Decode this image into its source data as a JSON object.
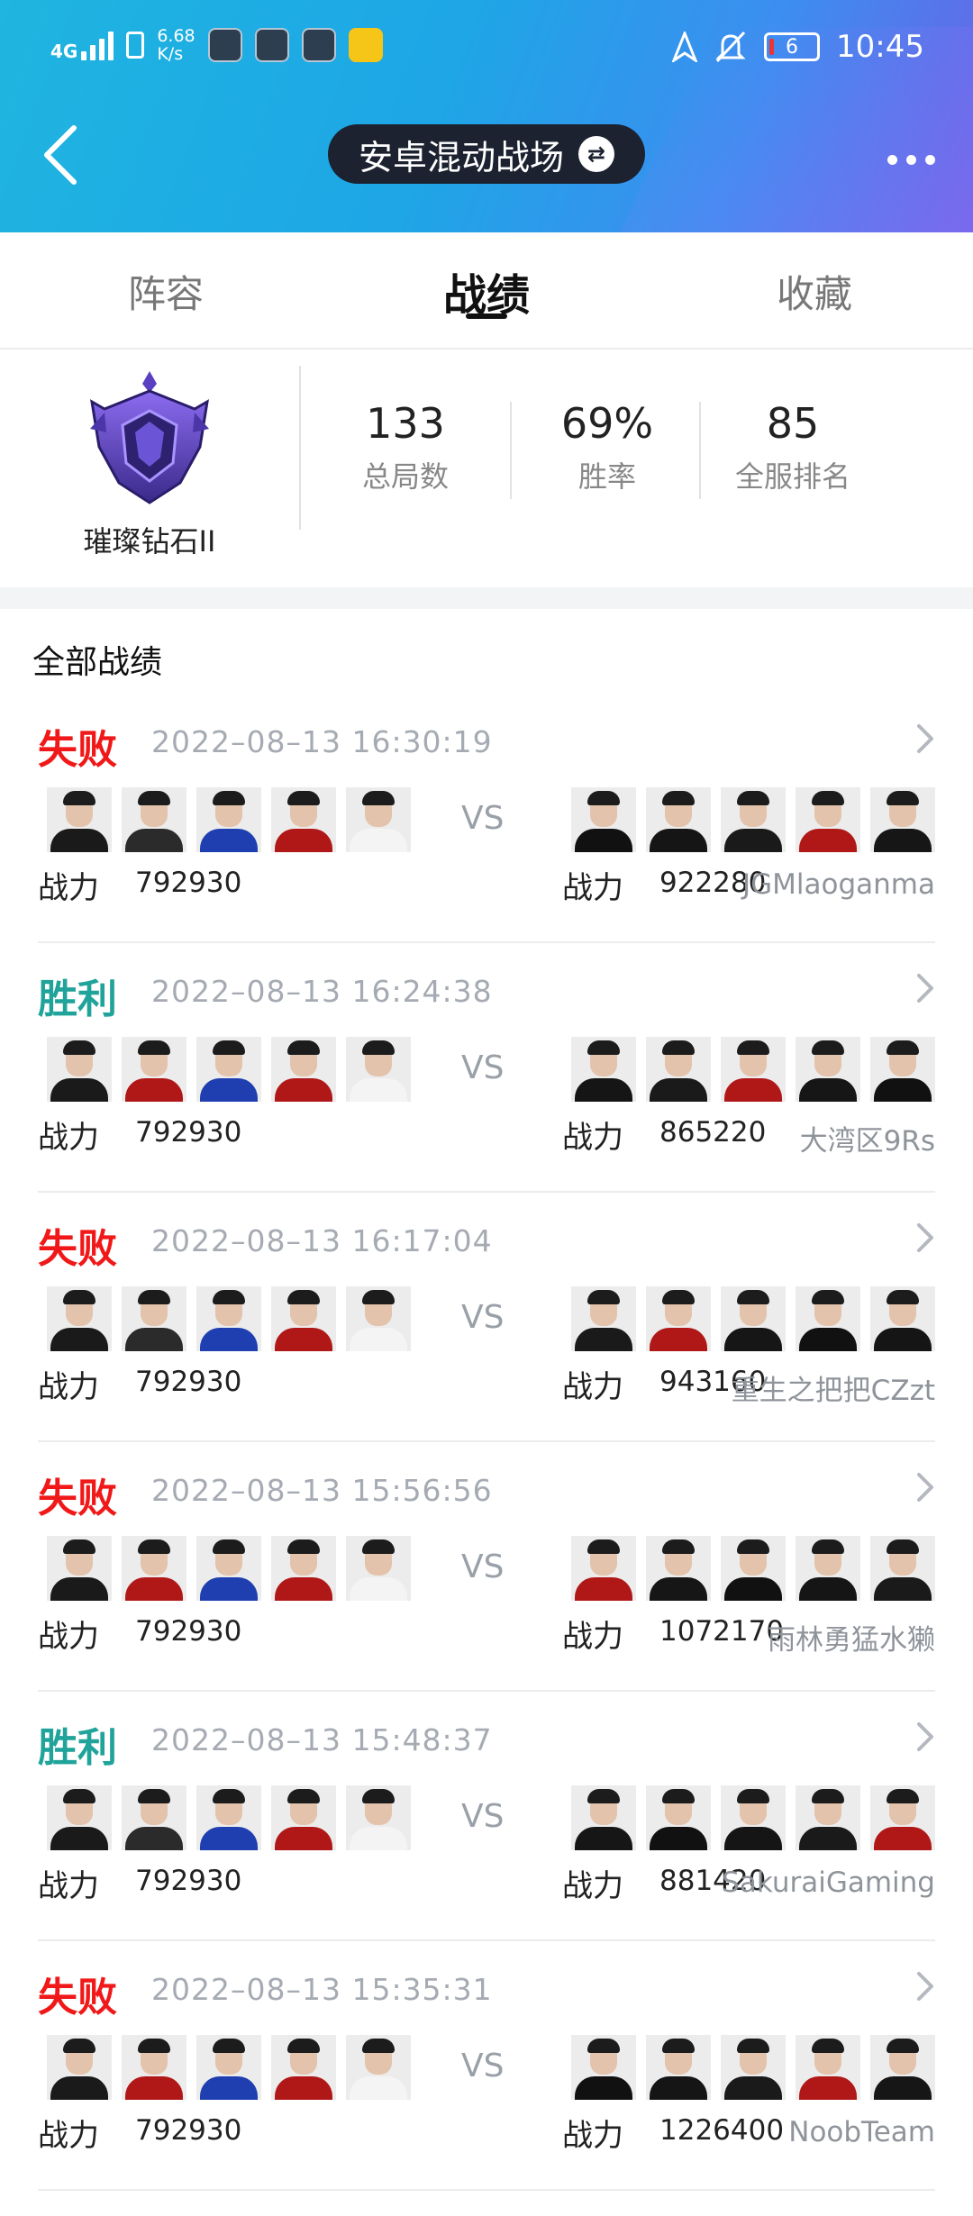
{
  "status_bar": {
    "network": "4G",
    "net_speed_value": "6.68",
    "net_speed_unit": "K/s",
    "battery_level": "6",
    "time": "10:45"
  },
  "header": {
    "title": "安卓混动战场",
    "swap_icon": "⇄"
  },
  "tabs": [
    {
      "label": "阵容",
      "active": false
    },
    {
      "label": "战绩",
      "active": true
    },
    {
      "label": "收藏",
      "active": false
    }
  ],
  "summary": {
    "rank_label": "璀璨钻石II",
    "stats": [
      {
        "value": "133",
        "label": "总局数"
      },
      {
        "value": "69%",
        "label": "胜率"
      },
      {
        "value": "85",
        "label": "全服排名"
      }
    ]
  },
  "records": {
    "section_title": "全部战绩",
    "power_label": "战力",
    "vs_label": "VS",
    "matches": [
      {
        "result": "失败",
        "result_type": "loss",
        "time": "2022–08–13  16:30:19",
        "my_power": "792930",
        "opp_power": "922280",
        "opp_team": "JGMlaoganma"
      },
      {
        "result": "胜利",
        "result_type": "win",
        "time": "2022–08–13  16:24:38",
        "my_power": "792930",
        "opp_power": "865220",
        "opp_team": "大湾区9Rs"
      },
      {
        "result": "失败",
        "result_type": "loss",
        "time": "2022–08–13  16:17:04",
        "my_power": "792930",
        "opp_power": "943160",
        "opp_team": "重生之把把CZzt"
      },
      {
        "result": "失败",
        "result_type": "loss",
        "time": "2022–08–13  15:56:56",
        "my_power": "792930",
        "opp_power": "1072170",
        "opp_team": "雨林勇猛水獭"
      },
      {
        "result": "胜利",
        "result_type": "win",
        "time": "2022–08–13  15:48:37",
        "my_power": "792930",
        "opp_power": "881420",
        "opp_team": "SakuraiGaming"
      },
      {
        "result": "失败",
        "result_type": "loss",
        "time": "2022–08–13  15:35:31",
        "my_power": "792930",
        "opp_power": "1226400",
        "opp_team": "NoobTeam"
      }
    ]
  },
  "colors": {
    "loss": "#f01818",
    "win": "#1fa39a",
    "header_start": "#1fb5e0",
    "header_end": "#6a63e6"
  }
}
